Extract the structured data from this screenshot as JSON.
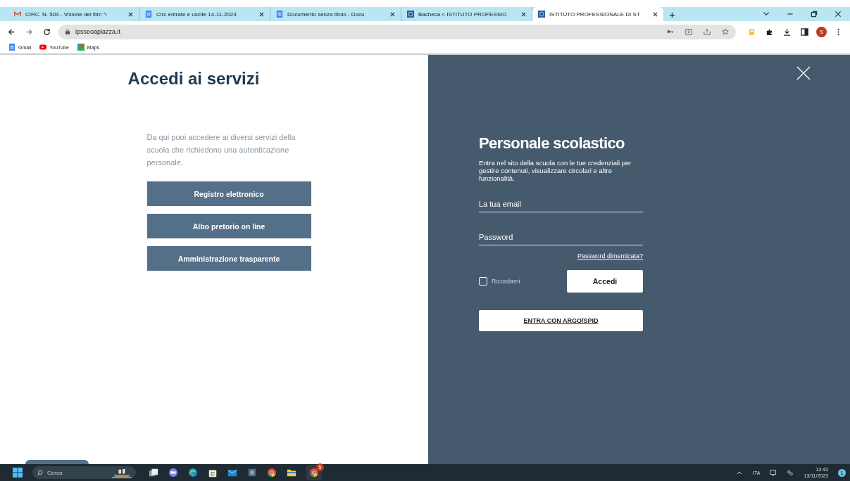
{
  "browser": {
    "tabs": [
      {
        "title": "CIRC. N. 504 - Visione del film \"I",
        "kind": "gmail",
        "selected": false
      },
      {
        "title": "Circ entrate e uscite 14-11-2023",
        "kind": "doc",
        "selected": false
      },
      {
        "title": "Documento senza titolo - Docu",
        "kind": "doc",
        "selected": false
      },
      {
        "title": "Bacheca < ISTITUTO PROFESSIO",
        "kind": "site",
        "selected": false
      },
      {
        "title": "ISTITUTO PROFESSIONALE DI ST",
        "kind": "site",
        "selected": true
      }
    ],
    "new_tab": "+",
    "address": "ipsseoapiazza.it",
    "avatar": "s",
    "bookmarks": [
      {
        "label": "Gmail",
        "kind": "doc"
      },
      {
        "label": "YouTube",
        "kind": "video"
      },
      {
        "label": "Maps",
        "kind": "map"
      }
    ]
  },
  "left": {
    "title": "Accedi ai servizi",
    "intro": "Da qui puoi accedere ai diversi servizi della scuola che richiedono una autenticazione personale.",
    "buttons": [
      "Registro elettronico",
      "Albo pretorio on line",
      "Amministrazione trasparente"
    ]
  },
  "login": {
    "title": "Personale scolastico",
    "description": "Entra nel sito della scuola con le tue credenziali per gestire contenuti, visualizzare circolari e altre funzionalità.",
    "email_placeholder": "La tua email",
    "password_placeholder": "Password",
    "forgot": "Password dimenticata?",
    "remember": {
      "label": "Ricordami",
      "checked": false
    },
    "submit": "Accedi",
    "spid": "ENTRA CON ARGO/SPID"
  },
  "taskbar": {
    "search_placeholder": "Cerca",
    "badge": "5",
    "language": "ITA",
    "time": "13:43",
    "date": "13/11/2023",
    "notifications": "1"
  }
}
